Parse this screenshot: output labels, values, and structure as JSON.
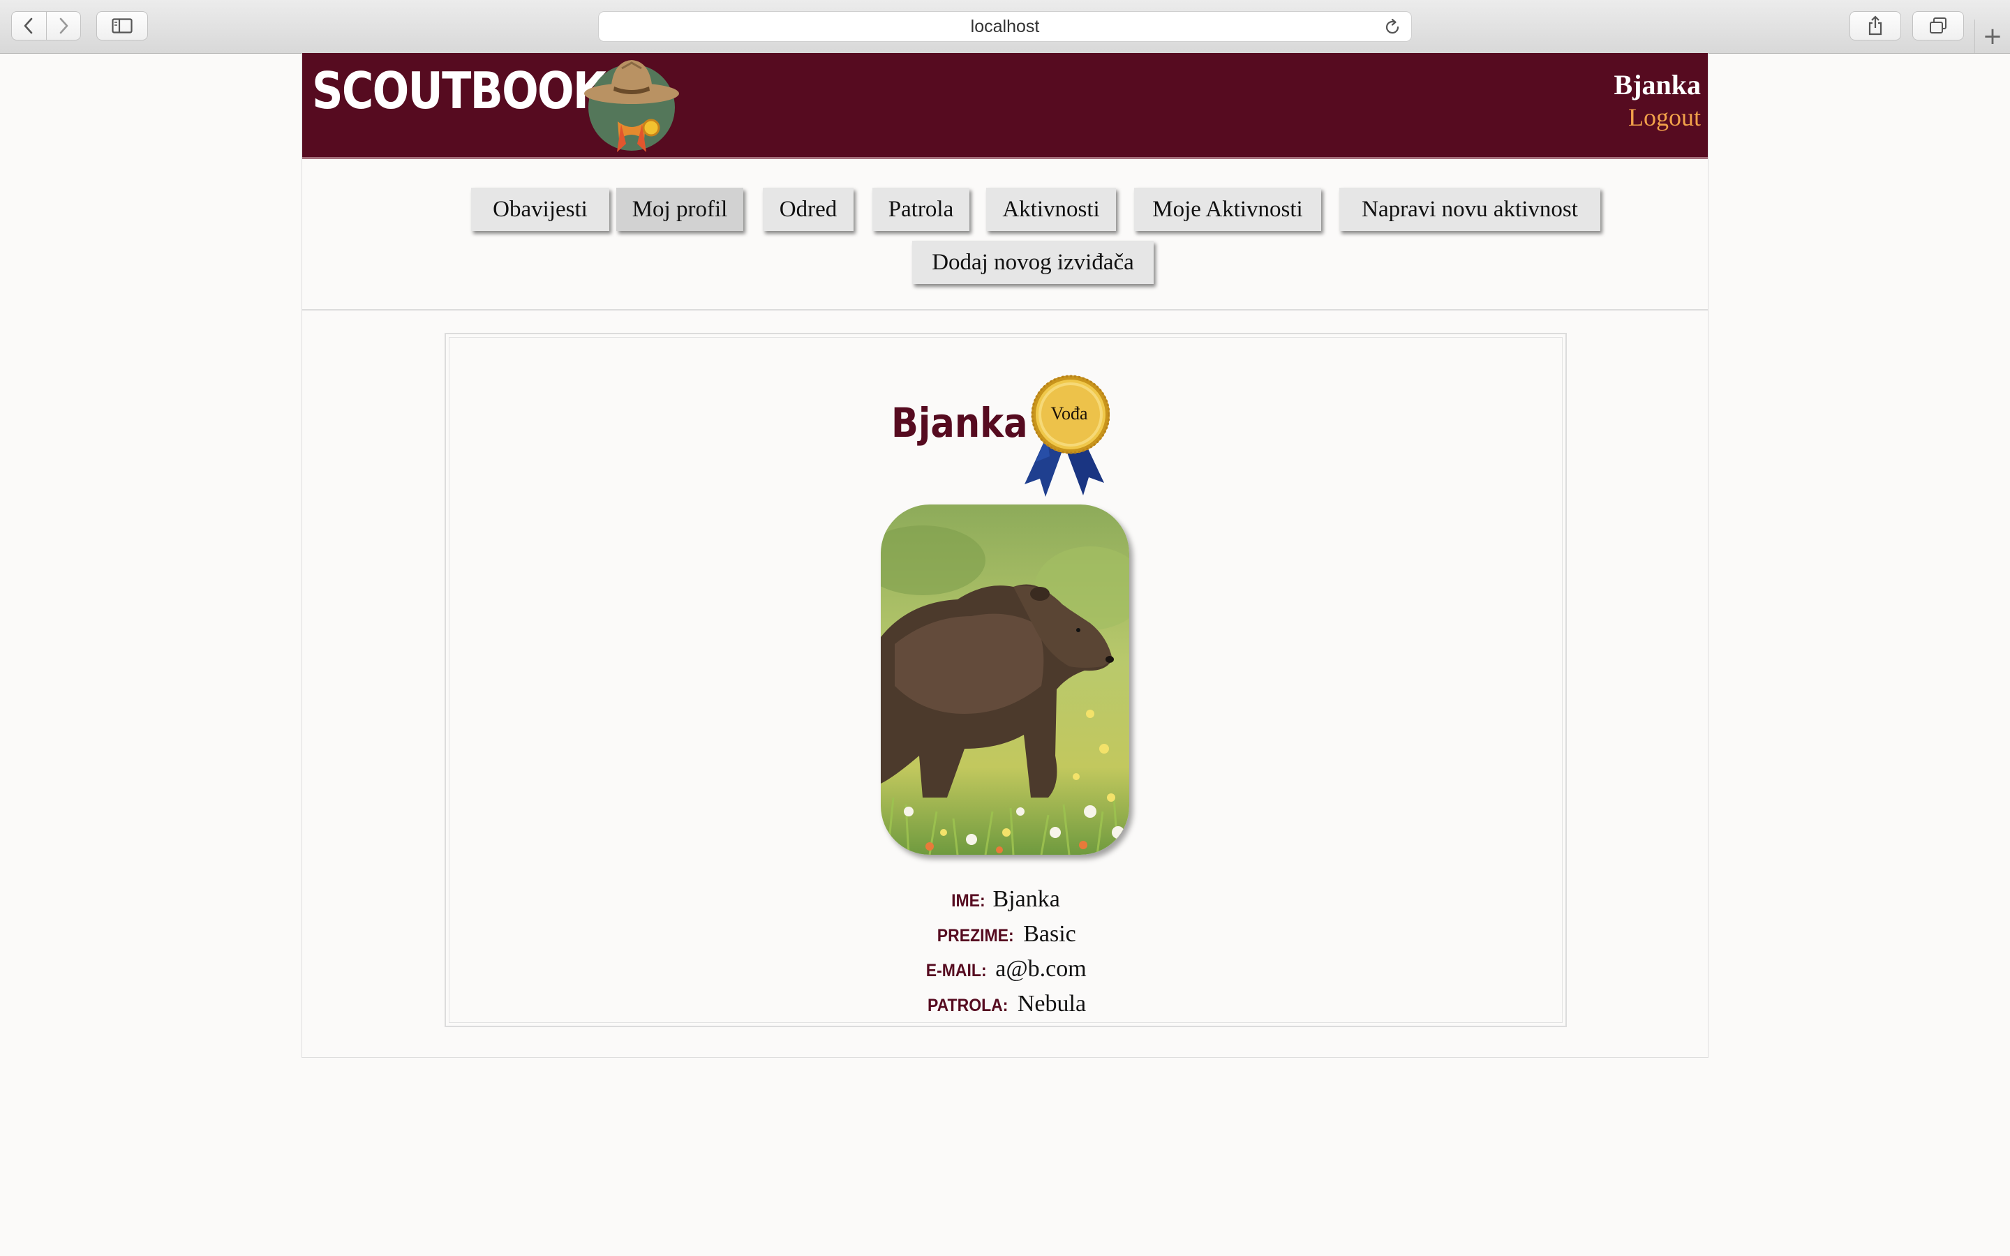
{
  "browser": {
    "url": "localhost"
  },
  "header": {
    "logo_text": "SCOUTBOOK",
    "user_name": "Bjanka",
    "logout_label": "Logout"
  },
  "nav": {
    "items": [
      {
        "label": "Obavijesti"
      },
      {
        "label": "Moj profil"
      },
      {
        "label": "Odred"
      },
      {
        "label": "Patrola"
      },
      {
        "label": "Aktivnosti"
      },
      {
        "label": "Moje Aktivnosti"
      },
      {
        "label": "Napravi novu aktivnost"
      },
      {
        "label": "Dodaj novog izviđača"
      }
    ],
    "active": "Moj profil"
  },
  "profile": {
    "name": "Bjanka",
    "badge": "Vođa",
    "fields": [
      {
        "label": "IME:",
        "value": "Bjanka"
      },
      {
        "label": "PREZIME:",
        "value": "Basic"
      },
      {
        "label": "E-MAIL:",
        "value": "a@b.com"
      },
      {
        "label": "PATROLA:",
        "value": "Nebula"
      }
    ]
  },
  "colors": {
    "brand": "#560b20",
    "accent": "#f1a14a"
  }
}
